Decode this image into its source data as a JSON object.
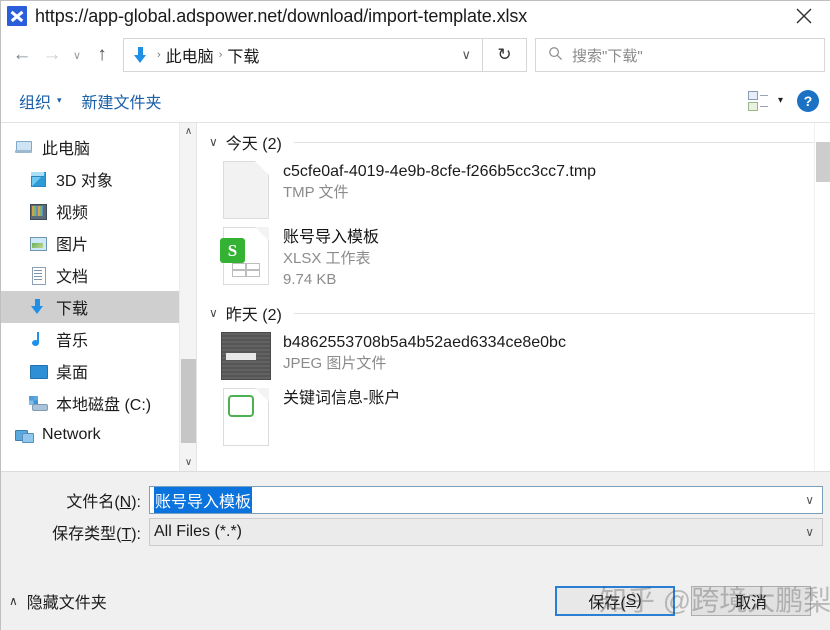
{
  "window": {
    "title": "https://app-global.adspower.net/download/import-template.xlsx",
    "icon": "browser-download-icon",
    "close_label": "✕"
  },
  "nav": {
    "back_label": "←",
    "forward_label": "→",
    "history_label": "∨",
    "up_label": "↑",
    "breadcrumb": {
      "icon": "download-folder-icon",
      "sep": "›",
      "items": [
        "此电脑",
        "下载"
      ]
    },
    "addr_caret": "∨",
    "refresh_label": "↻"
  },
  "search": {
    "icon": "search-icon",
    "placeholder": "搜索\"下载\""
  },
  "toolbar": {
    "organize_label": "组织",
    "organize_caret": "▾",
    "new_folder_label": "新建文件夹",
    "view_caret": "▾",
    "help_label": "?"
  },
  "sidebar": {
    "scroll_up": "∧",
    "scroll_down": "∨",
    "items": [
      {
        "label": "此电脑",
        "icon": "computer-icon",
        "indent": false,
        "selected": false
      },
      {
        "label": "3D 对象",
        "icon": "3d-objects-icon",
        "indent": true,
        "selected": false
      },
      {
        "label": "视频",
        "icon": "videos-icon",
        "indent": true,
        "selected": false
      },
      {
        "label": "图片",
        "icon": "pictures-icon",
        "indent": true,
        "selected": false
      },
      {
        "label": "文档",
        "icon": "documents-icon",
        "indent": true,
        "selected": false
      },
      {
        "label": "下载",
        "icon": "downloads-icon",
        "indent": true,
        "selected": true
      },
      {
        "label": "音乐",
        "icon": "music-icon",
        "indent": true,
        "selected": false
      },
      {
        "label": "桌面",
        "icon": "desktop-icon",
        "indent": true,
        "selected": false
      },
      {
        "label": "本地磁盘 (C:)",
        "icon": "local-disk-icon",
        "indent": true,
        "selected": false
      },
      {
        "label": "Network",
        "icon": "network-icon",
        "indent": false,
        "selected": false
      }
    ]
  },
  "filelist": {
    "groups": [
      {
        "caret": "∨",
        "name": "今天 (2)",
        "files": [
          {
            "name": "c5cfe0af-4019-4e9b-8cfe-f266b5cc3cc7.tmp",
            "type": "TMP 文件",
            "size": "",
            "icon": "blank-file-icon"
          },
          {
            "name": "账号导入模板",
            "type": "XLSX 工作表",
            "size": "9.74 KB",
            "icon": "xlsx-file-icon"
          }
        ]
      },
      {
        "caret": "∨",
        "name": "昨天 (2)",
        "files": [
          {
            "name": "b4862553708b5a4b52aed6334ce8e0bc",
            "type": "JPEG 图片文件",
            "size": "",
            "icon": "jpeg-thumbnail-icon"
          },
          {
            "name": "关键词信息-账户",
            "type": "",
            "size": "",
            "icon": "spreadsheet-file-icon"
          }
        ]
      }
    ]
  },
  "form": {
    "filename_label": "文件名(N):",
    "filename_label_prefix": "文件名(",
    "filename_accel": "N",
    "filename_label_suffix": "):",
    "filename_value": "账号导入模板",
    "savetype_label_prefix": "保存类型(",
    "savetype_accel": "T",
    "savetype_label_suffix": "):",
    "savetype_value": "All Files (*.*)",
    "caret": "∨"
  },
  "footer": {
    "hide_folders_caret": "∧",
    "hide_folders_label": "隐藏文件夹",
    "save_prefix": "保存(",
    "save_accel": "S",
    "save_suffix": ")",
    "cancel_label": "取消"
  },
  "watermark": {
    "text": "知乎 @跨境大鹏梨"
  },
  "colors": {
    "accent": "#0a73dd",
    "link": "#1a5fa8",
    "primary_button_border": "#2a7fd4",
    "selection": "#cfcfcf",
    "excel_green": "#34b233"
  }
}
